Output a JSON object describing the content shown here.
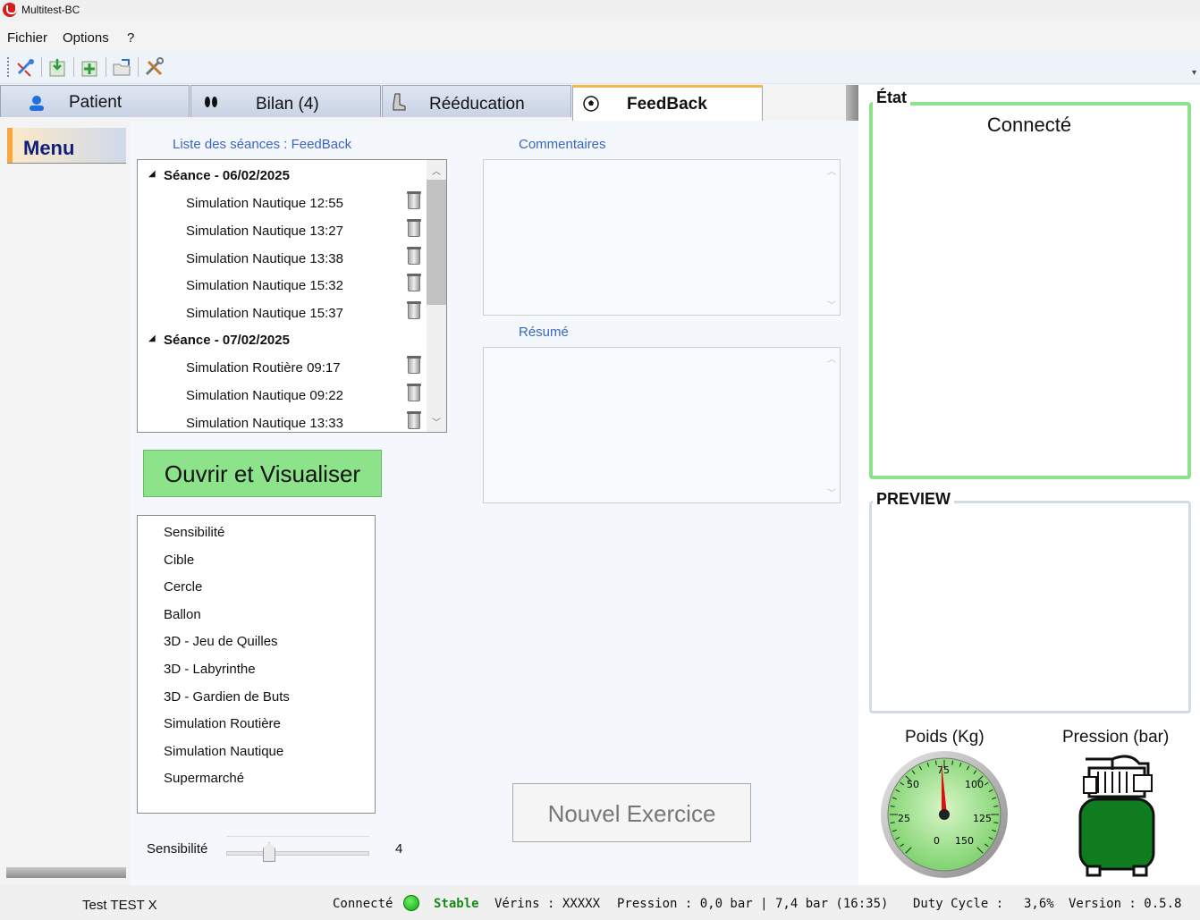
{
  "window": {
    "title": "Multitest-BC"
  },
  "menubar": {
    "items": [
      "Fichier",
      "Options",
      "?"
    ]
  },
  "toolbar": {
    "buttons": [
      "connect-icon",
      "import-icon",
      "add-icon",
      "open-folder-icon",
      "tools-icon"
    ]
  },
  "tabs": [
    {
      "label": "Patient",
      "icon": "person-icon"
    },
    {
      "label": "Bilan (4)",
      "icon": "footprints-icon"
    },
    {
      "label": "Rééducation",
      "icon": "boot-icon"
    },
    {
      "label": "FeedBack",
      "icon": "soccer-ball-icon",
      "active": true
    }
  ],
  "sidebar": {
    "menu_label": "Menu"
  },
  "sessions": {
    "label": "Liste des séances : FeedBack",
    "groups": [
      {
        "title": "Séance - 06/02/2025",
        "items": [
          "Simulation Nautique 12:55",
          "Simulation Nautique 13:27",
          "Simulation Nautique 13:38",
          "Simulation Nautique 15:32",
          "Simulation Nautique 15:37"
        ]
      },
      {
        "title": "Séance - 07/02/2025",
        "items": [
          "Simulation Routière 09:17",
          "Simulation Nautique 09:22",
          "Simulation Nautique 13:33"
        ]
      }
    ]
  },
  "open_button": "Ouvrir et Visualiser",
  "exercises": [
    "Sensibilité",
    "Cible",
    "Cercle",
    "Ballon",
    "3D - Jeu de Quilles",
    "3D - Labyrinthe",
    "3D - Gardien de Buts",
    "Simulation Routière",
    "Simulation Nautique",
    "Supermarché"
  ],
  "sensitivity": {
    "label": "Sensibilité",
    "value": "4",
    "min": 0,
    "max": 10
  },
  "comments": {
    "label": "Commentaires",
    "value": ""
  },
  "summary": {
    "label": "Résumé",
    "value": ""
  },
  "new_exercise_button": "Nouvel Exercice",
  "etat": {
    "title": "État",
    "status": "Connecté",
    "border_color": "#8ee08b"
  },
  "preview": {
    "title": "PREVIEW"
  },
  "gauges": {
    "weight": {
      "label": "Poids (Kg)",
      "ticks": [
        "0",
        "25",
        "50",
        "75",
        "100",
        "125",
        "150"
      ],
      "value": 75
    },
    "pressure": {
      "label": "Pression (bar)",
      "tank_color": "#0f7d1f"
    }
  },
  "statusbar": {
    "patient": "Test TEST  X",
    "connected": "Connecté",
    "stable": "Stable",
    "verins": "Vérins : XXXXX",
    "pression": "Pression : 0,0 bar | 7,4 bar (16:35)",
    "duty": "Duty Cycle :",
    "duty_value": "3,6%",
    "version": "Version : 0.5.8"
  }
}
